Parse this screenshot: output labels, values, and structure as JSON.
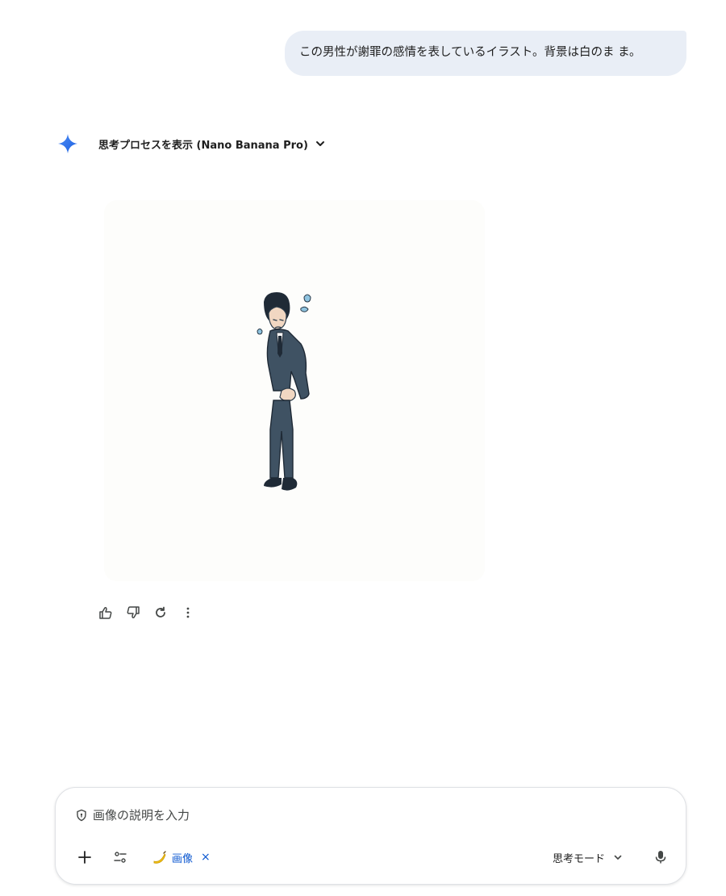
{
  "user_message": {
    "text": "この男性が謝罪の感情を表しているイラスト。背景は白のま ま。"
  },
  "response": {
    "thinking_label": "思考プロセスを表示 (Nano Banana Pro)",
    "icons": {
      "sparkle": "gemini-sparkle-icon",
      "chevron": "chevron-down-icon"
    },
    "image": {
      "subject": "bowing-businessman-illustration"
    },
    "actions": [
      {
        "name": "thumbs-up-icon"
      },
      {
        "name": "thumbs-down-icon"
      },
      {
        "name": "regenerate-icon"
      },
      {
        "name": "more-options-icon"
      }
    ]
  },
  "composer": {
    "placeholder": "画像の説明を入力",
    "chip_label": "画像",
    "chip_close": "×",
    "mode_label": "思考モード",
    "icons": [
      "shield-icon",
      "plus-icon",
      "tools-icon",
      "banana-icon",
      "close-icon",
      "chevron-down-icon",
      "mic-icon"
    ]
  },
  "colors": {
    "bubble_bg": "#e9eef6",
    "accent_blue": "#0b57d0",
    "text": "#1f1f1f"
  }
}
